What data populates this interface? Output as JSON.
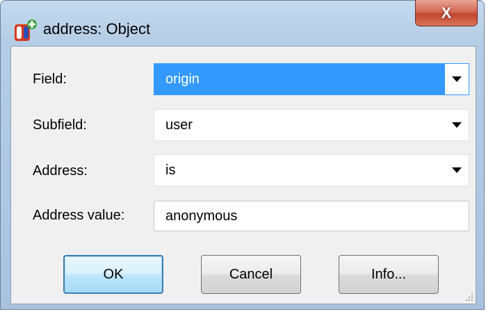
{
  "window": {
    "title": "address: Object",
    "close_symbol": "X"
  },
  "form": {
    "field_label": "Field:",
    "field_value": "origin",
    "subfield_label": "Subfield:",
    "subfield_value": "user",
    "address_label": "Address:",
    "address_value": "is",
    "address_value_label": "Address value:",
    "address_value_text": "anonymous"
  },
  "buttons": {
    "ok": "OK",
    "cancel": "Cancel",
    "info": "Info..."
  },
  "colors": {
    "selection": "#3399ff",
    "titlebar": "#b5cde6",
    "close": "#c2452d"
  },
  "icons": [
    "app-icon",
    "close-icon",
    "dropdown-arrow-icon",
    "resize-grip-icon"
  ]
}
